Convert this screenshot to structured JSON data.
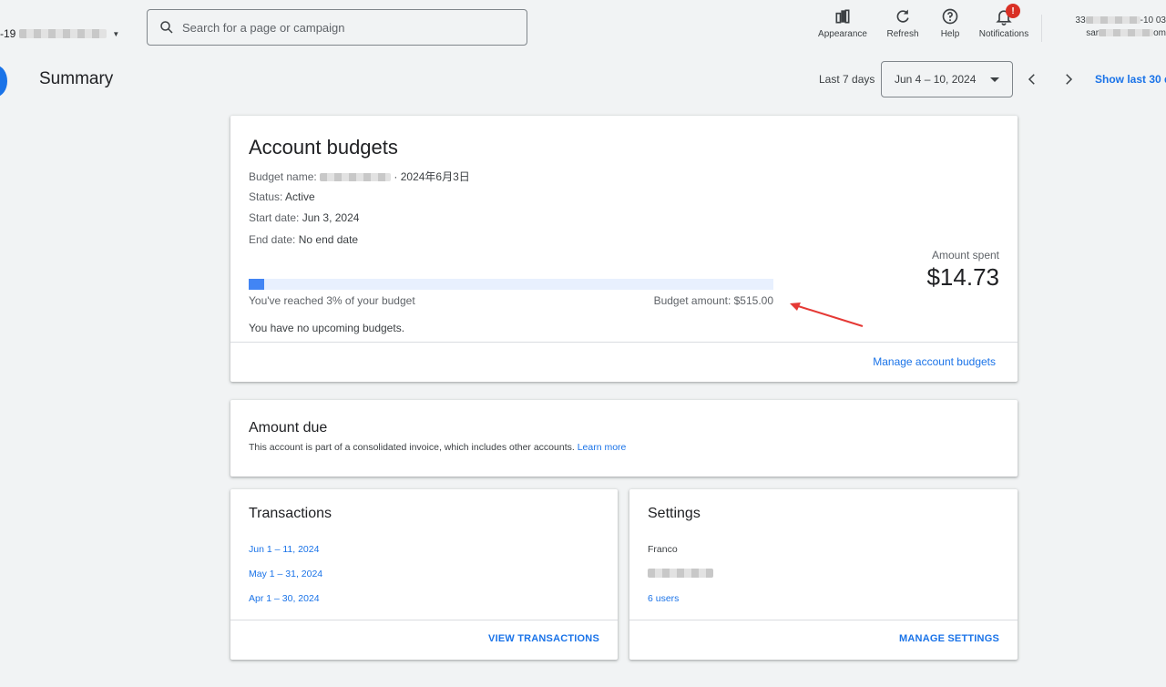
{
  "topbar": {
    "account_id_prefix": "-19",
    "search_placeholder": "Search for a page or campaign",
    "tools": {
      "appearance": "Appearance",
      "refresh": "Refresh",
      "help": "Help",
      "notifications": "Notifications",
      "notifications_badge": "!"
    },
    "account_line1": "33",
    "account_line1_tail": "-10 03",
    "account_line2": "sar",
    "account_line2_tail": "om"
  },
  "header": {
    "title": "Summary",
    "range_label": "Last 7 days",
    "range_value": "Jun 4 – 10, 2024",
    "show_last": "Show last 30 d"
  },
  "budget": {
    "title": "Account budgets",
    "name_label": "Budget name:",
    "name_value_tail": "· 2024年6月3日",
    "status_label": "Status:",
    "status_value": "Active",
    "start_label": "Start date:",
    "start_value": "Jun 3, 2024",
    "end_label": "End date:",
    "end_value": "No end date",
    "progress_fraction": 0.03,
    "reached_text": "You've reached 3% of your budget",
    "amount_text": "Budget amount: $515.00",
    "upcoming_text": "You have no upcoming budgets.",
    "spent_label": "Amount spent",
    "spent_value": "$14.73",
    "manage_link": "Manage account budgets",
    "accent": "#4285f4"
  },
  "amount_due": {
    "title": "Amount due",
    "text": "This account is part of a consolidated invoice, which includes other accounts.",
    "learn_more": "Learn more"
  },
  "transactions": {
    "title": "Transactions",
    "items": [
      "Jun 1 – 11, 2024",
      "May 1 – 31, 2024",
      "Apr 1 – 30, 2024"
    ],
    "action": "VIEW TRANSACTIONS"
  },
  "settings": {
    "title": "Settings",
    "name": "Franco",
    "users": "6 users",
    "action": "MANAGE SETTINGS"
  }
}
